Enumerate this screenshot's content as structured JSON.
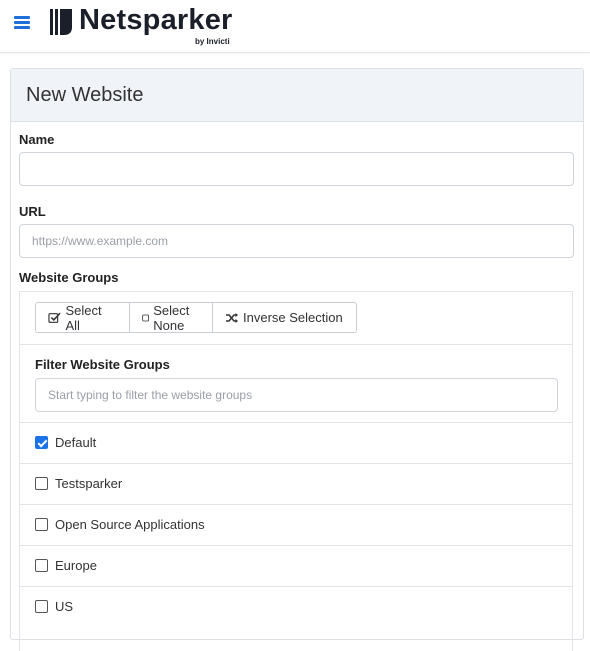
{
  "header": {
    "menu_icon": "hamburger-menu-icon",
    "logo_text": "Netsparker",
    "logo_sub": "by Invicti"
  },
  "form": {
    "title": "New Website",
    "name_label": "Name",
    "name_value": "",
    "url_label": "URL",
    "url_placeholder": "https://www.example.com",
    "groups_label": "Website Groups",
    "buttons": {
      "select_all": "Select All",
      "select_none": "Select None",
      "inverse": "Inverse Selection"
    },
    "filter_label": "Filter Website Groups",
    "filter_placeholder": "Start typing to filter the website groups",
    "groups": [
      {
        "label": "Default",
        "checked": true
      },
      {
        "label": "Testsparker",
        "checked": false
      },
      {
        "label": "Open Source Applications",
        "checked": false
      },
      {
        "label": "Europe",
        "checked": false
      },
      {
        "label": "US",
        "checked": false
      }
    ]
  },
  "colors": {
    "accent": "#1a73e8",
    "header_bg": "#f0f3f8",
    "logo_dark": "#1b1f2a"
  }
}
